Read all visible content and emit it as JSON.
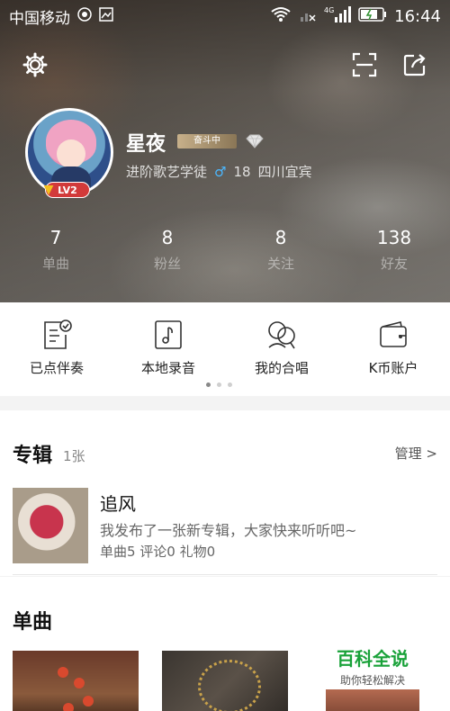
{
  "status_bar": {
    "carrier": "中国移动",
    "network": "4G",
    "time": "16:44"
  },
  "header": {
    "icons": [
      "gear-icon",
      "scan-icon",
      "share-icon"
    ]
  },
  "profile": {
    "nickname": "星夜",
    "rank_tag": "奋斗中",
    "level": "LV2",
    "title": "进阶歌艺学徒",
    "gender": "male",
    "age": "18",
    "location": "四川宜宾"
  },
  "stats": [
    {
      "value": "7",
      "label": "单曲"
    },
    {
      "value": "8",
      "label": "粉丝"
    },
    {
      "value": "8",
      "label": "关注"
    },
    {
      "value": "138",
      "label": "好友"
    }
  ],
  "quick_menu": [
    {
      "label": "已点伴奏",
      "icon": "checklist-icon"
    },
    {
      "label": "本地录音",
      "icon": "music-note-icon"
    },
    {
      "label": "我的合唱",
      "icon": "duet-icon"
    },
    {
      "label": "K币账户",
      "icon": "wallet-icon"
    }
  ],
  "album": {
    "section_title": "专辑",
    "count": "1张",
    "manage_label": "管理 >",
    "title": "追风",
    "desc": "我发布了一张新专辑，大家快来听听吧~",
    "meta": "单曲5 评论0 礼物0"
  },
  "singles": {
    "section_title": "单曲"
  },
  "watermark": {
    "big": "百科全说",
    "small": "助你轻松解决"
  },
  "colors": {
    "accent_green": "#1aa23a",
    "level_red": "#d23a3a",
    "gender_blue": "#4bb8ff"
  }
}
